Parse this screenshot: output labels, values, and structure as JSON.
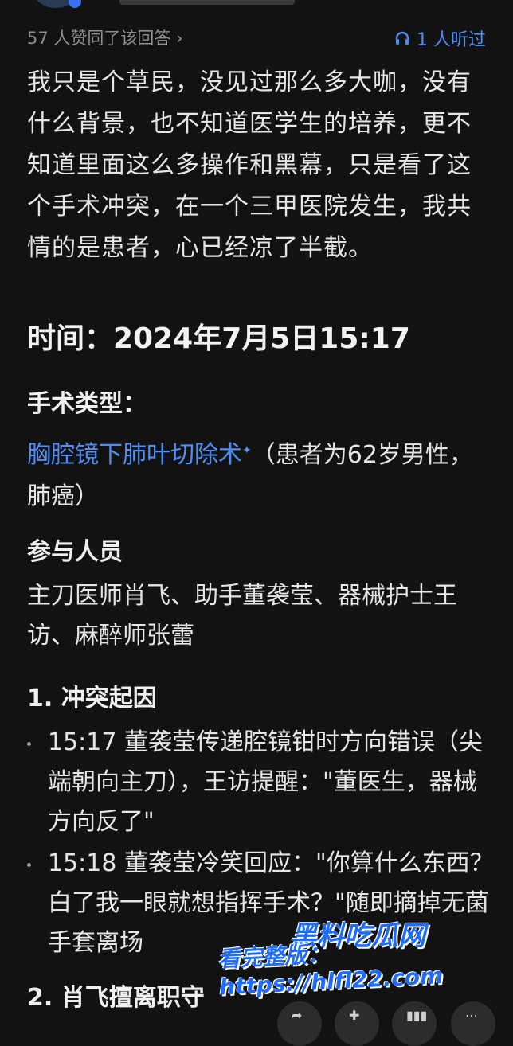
{
  "header": {
    "likes": "57 人赞同了该回答 ›",
    "listen": "1 人听过"
  },
  "content": {
    "intro": "我只是个草民，没见过那么多大咖，没有什么背景，也不知道医学生的培养，更不知道里面这么多操作和黑幕，只是看了这个手术冲突，在一个三甲医院发生，我共情的是患者，心已经凉了半截。",
    "time": "时间：2024年7月5日15:17",
    "surgery_heading": "手术类型：",
    "surgery_link": "胸腔镜下肺叶切除术",
    "surgery_rest": "（患者为62岁男性，肺癌）",
    "people_heading": "参与人员",
    "people": "主刀医师肖飞、助手董袭莹、器械护士王访、麻醉师张蕾",
    "cause_heading": "1. 冲突起因",
    "bullets": [
      "15:17 董袭莹传递腔镜钳时方向错误（尖端朝向主刀），王访提醒：\"董医生，器械方向反了\"",
      "15:18 董袭莹冷笑回应：\"你算什么东西？白了我一眼就想指挥手术？\"随即摘掉无菌手套离场"
    ],
    "leave_heading": "2. 肖飞擅离职守"
  },
  "watermark": {
    "brand": "黑料吃瓜网",
    "url": "看完整版：https://hlfl22.com"
  },
  "icons": {
    "listen": "headphones-icon",
    "sparkle": "sparkle-icon"
  },
  "colors": {
    "background": "#121212",
    "link": "#4e8ef7",
    "watermark": "#1e6bff"
  }
}
